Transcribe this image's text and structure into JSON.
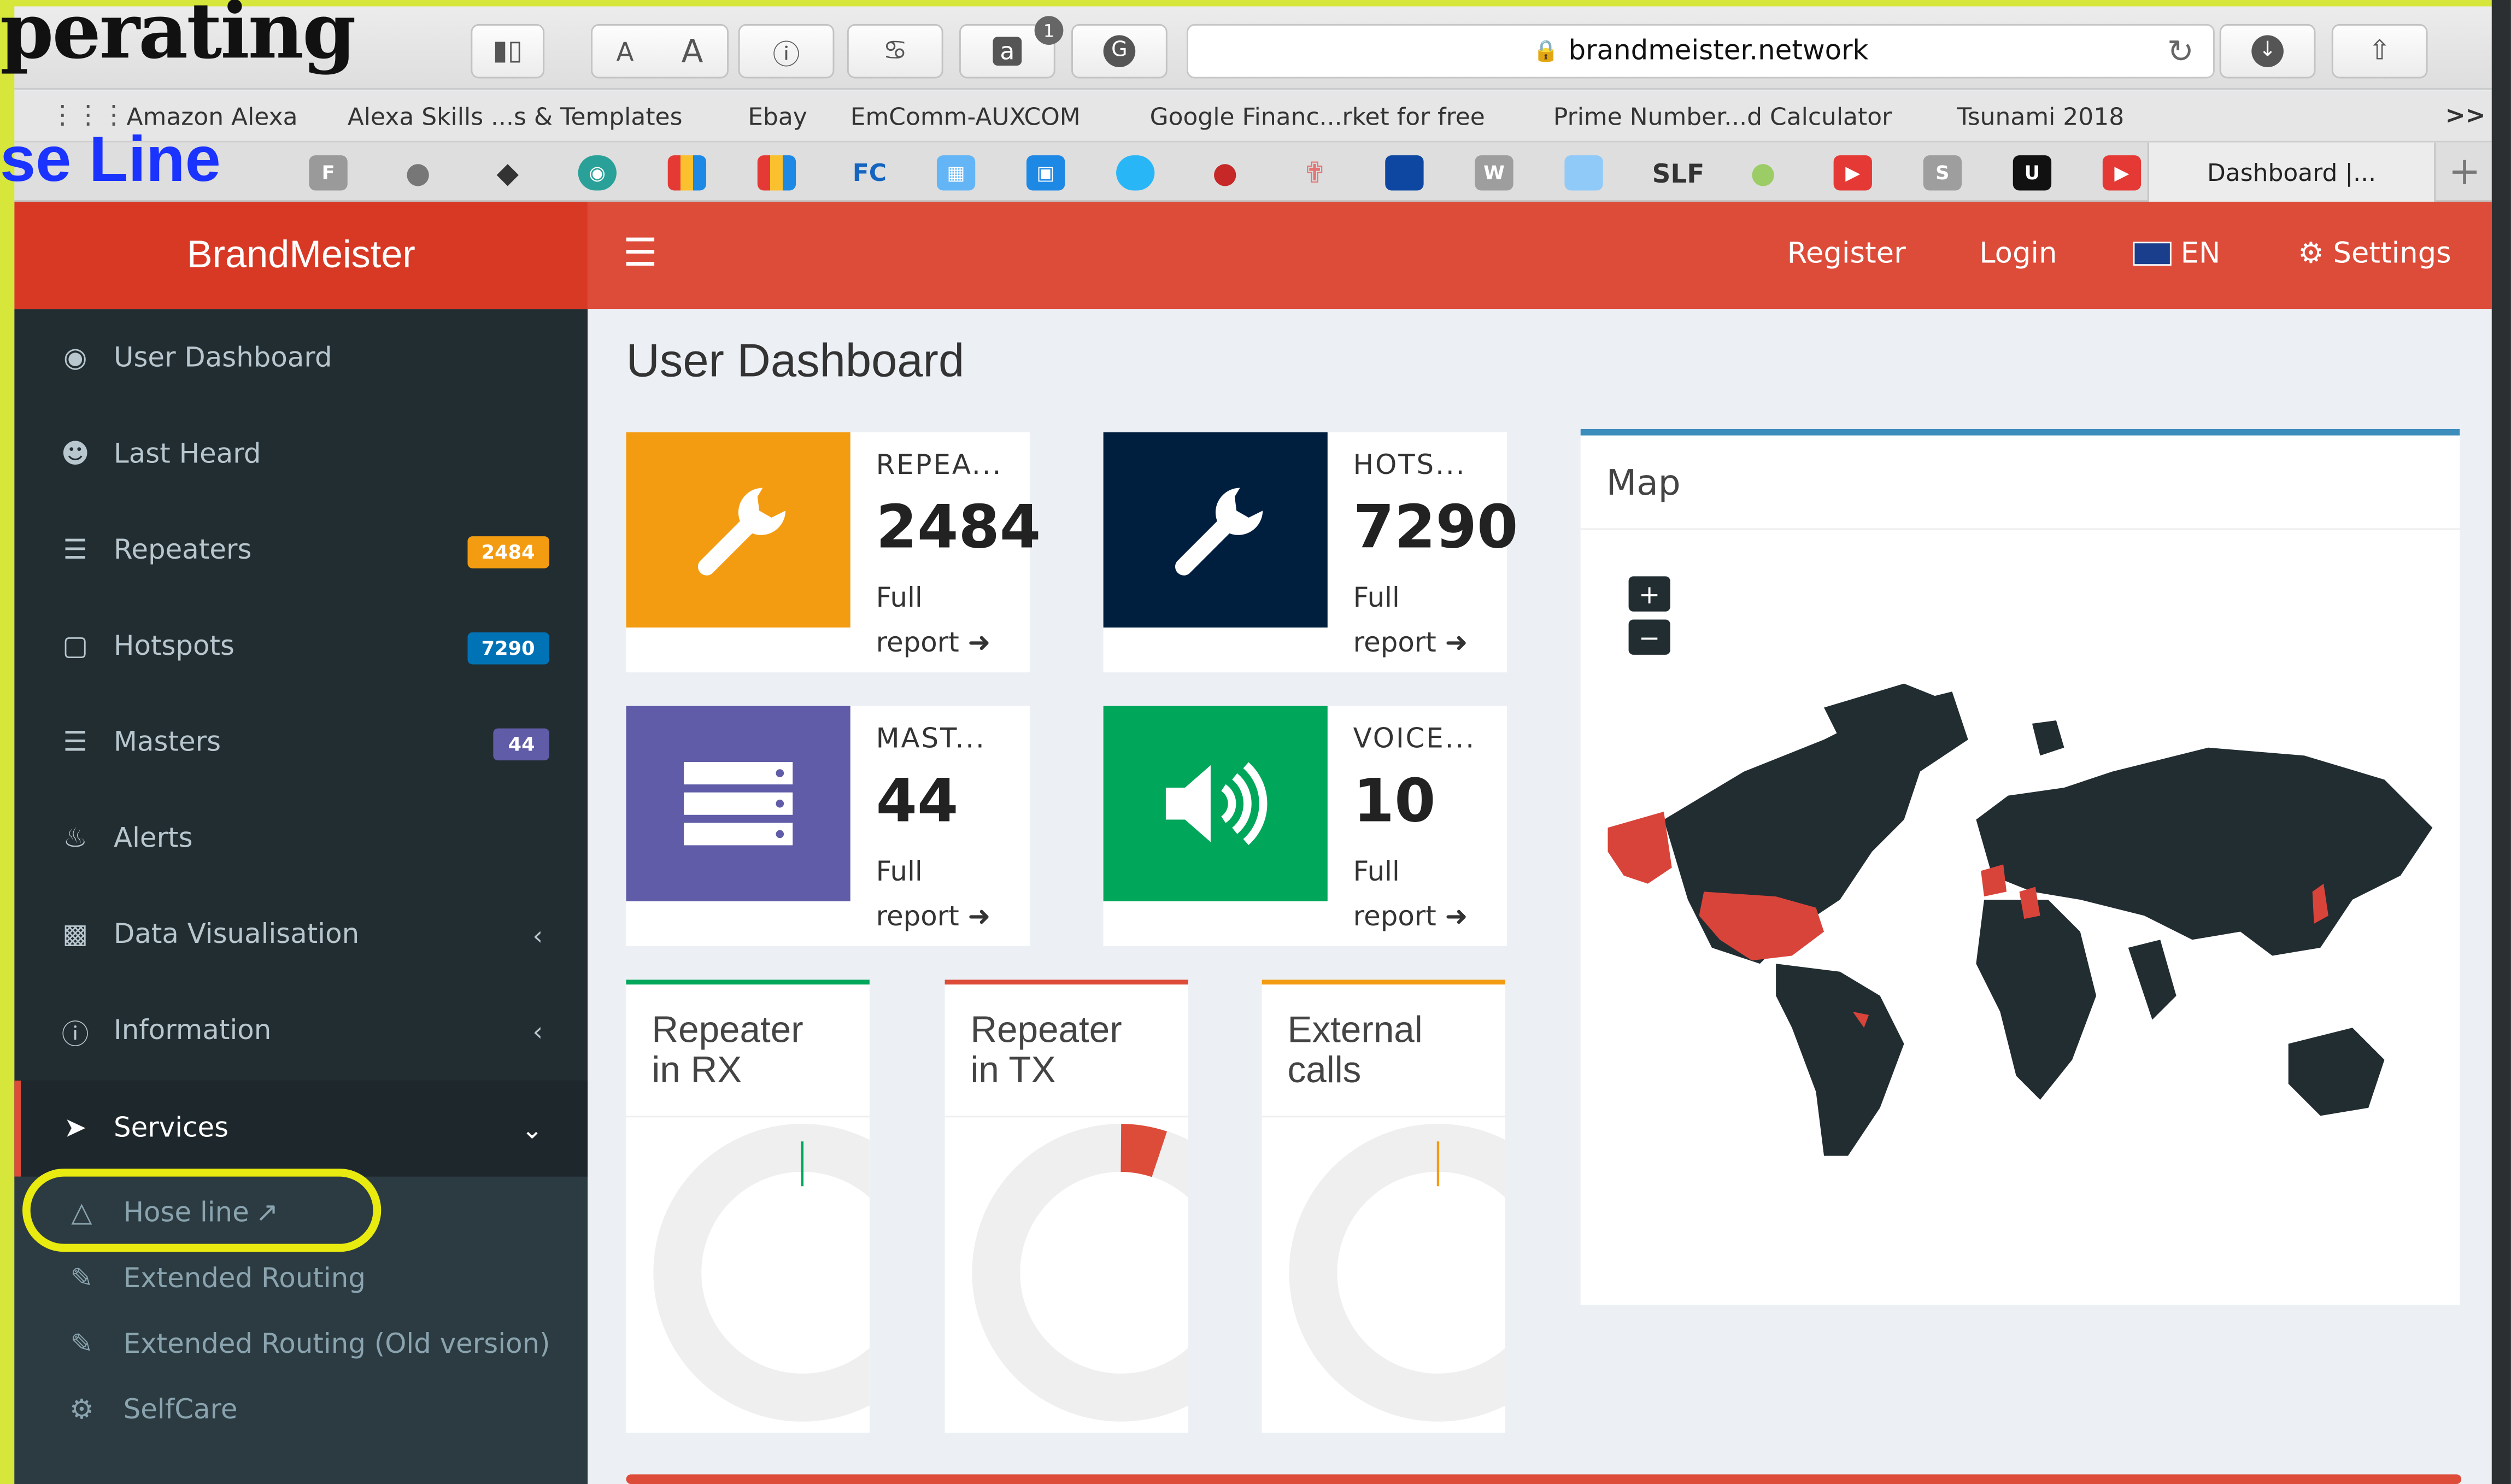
{
  "overlay": {
    "top_text": "perating",
    "mid_text": "se Line"
  },
  "browser": {
    "address": "brandmeister.network",
    "toolbar_text_small": "A",
    "toolbar_text_large": "A",
    "badge_count": "1",
    "bookmarks": [
      "Amazon Alexa",
      "Alexa Skills ...s & Templates",
      "Ebay",
      "EmComm-AUXCOM",
      "Google Financ...rket for free",
      "Prime Number...d Calculator",
      "Tsunami 2018"
    ],
    "bookmarks_more": ">>",
    "tab_label": "Dashboard |...",
    "new_tab": "+",
    "fav_labels": {
      "f": "F",
      "fc": "FC",
      "w": "W",
      "s": "S",
      "u": "U",
      "slf": "SLF"
    }
  },
  "app": {
    "brand": "BrandMeister",
    "menu_icon": "hamburger-icon",
    "nav": {
      "register": "Register",
      "login": "Login",
      "lang": "EN",
      "settings": "Settings"
    }
  },
  "sidebar": {
    "items": [
      {
        "label": "User Dashboard",
        "icon": "dashboard-icon"
      },
      {
        "label": "Last Heard",
        "icon": "user-icon"
      },
      {
        "label": "Repeaters",
        "icon": "server-icon",
        "badge": "2484",
        "badge_color": "#f39c12"
      },
      {
        "label": "Hotspots",
        "icon": "briefcase-icon",
        "badge": "7290",
        "badge_color": "#0073b7"
      },
      {
        "label": "Masters",
        "icon": "server-icon",
        "badge": "44",
        "badge_color": "#605ca8"
      },
      {
        "label": "Alerts",
        "icon": "bell-icon"
      },
      {
        "label": "Data Visualisation",
        "icon": "bar-chart-icon",
        "chevron": "‹"
      },
      {
        "label": "Information",
        "icon": "info-icon",
        "chevron": "‹"
      },
      {
        "label": "Services",
        "icon": "rocket-icon",
        "chevron": "⌄"
      }
    ],
    "sub_items": [
      {
        "label": "Hose line",
        "icon": "fire-extinguisher-icon"
      },
      {
        "label": "Extended Routing",
        "icon": "magic-wand-icon"
      },
      {
        "label": "Extended Routing (Old version)",
        "icon": "magic-wand-icon"
      },
      {
        "label": "SelfCare",
        "icon": "gear-icon"
      }
    ]
  },
  "main": {
    "title": "User Dashboard",
    "cards": [
      {
        "label": "REPEA...",
        "value": "2484",
        "more1": "Full",
        "more2": "report",
        "color": "#f39c12",
        "icon": "wrench-icon"
      },
      {
        "label": "HOTS...",
        "value": "7290",
        "more1": "Full",
        "more2": "report",
        "color": "#001f3f",
        "icon": "wrench-icon"
      },
      {
        "label": "MAST...",
        "value": "44",
        "more1": "Full",
        "more2": "report",
        "color": "#605ca8",
        "icon": "server-icon"
      },
      {
        "label": "VOICE...",
        "value": "10",
        "more1": "Full",
        "more2": "report",
        "color": "#00a65a",
        "icon": "volume-icon"
      }
    ],
    "boxes": [
      {
        "title1": "Repeater",
        "title2": "in RX",
        "border": "#00a65a"
      },
      {
        "title1": "Repeater",
        "title2": "in TX",
        "border": "#dd4b39"
      },
      {
        "title1": "External",
        "title2": "calls",
        "border": "#f39c12"
      }
    ],
    "map": {
      "title": "Map",
      "zoom_in": "+",
      "zoom_out": "−",
      "highlight_color": "#d9443a"
    }
  }
}
